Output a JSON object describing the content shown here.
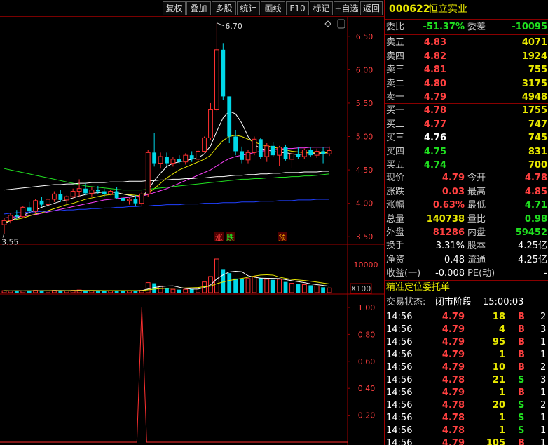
{
  "toolbar": {
    "buttons": [
      "复权",
      "叠加",
      "多股",
      "统计",
      "画线",
      "F10",
      "标记",
      "+自选",
      "返回"
    ]
  },
  "stock": {
    "code": "000622",
    "name": "恒立实业"
  },
  "chart": {
    "price_ticks": [
      "6.50",
      "6.00",
      "5.50",
      "5.00",
      "4.50",
      "4.00",
      "3.50"
    ],
    "high_label": "6.70",
    "low_label": "3.55",
    "markers": [
      {
        "text": "涨",
        "color": "#ff4040"
      },
      {
        "text": "跌",
        "color": "#20e020"
      },
      {
        "text": "预",
        "color": "#e8a000"
      }
    ],
    "volume_tick": "10000",
    "volume_unit": "X100",
    "indicator_ticks": [
      "1.00",
      "0.80",
      "0.60",
      "0.40",
      "0.20"
    ]
  },
  "chart_data": {
    "type": "candlestick",
    "ylim": [
      3.45,
      6.75
    ],
    "candles": [
      {
        "o": 3.68,
        "h": 3.78,
        "l": 3.55,
        "c": 3.74
      },
      {
        "o": 3.74,
        "h": 3.86,
        "l": 3.7,
        "c": 3.82
      },
      {
        "o": 3.82,
        "h": 3.9,
        "l": 3.76,
        "c": 3.8
      },
      {
        "o": 3.8,
        "h": 3.96,
        "l": 3.78,
        "c": 3.94
      },
      {
        "o": 3.94,
        "h": 4.02,
        "l": 3.86,
        "c": 3.88
      },
      {
        "o": 3.88,
        "h": 4.06,
        "l": 3.86,
        "c": 4.04
      },
      {
        "o": 4.04,
        "h": 4.1,
        "l": 3.95,
        "c": 3.98
      },
      {
        "o": 3.98,
        "h": 4.08,
        "l": 3.94,
        "c": 4.06
      },
      {
        "o": 4.06,
        "h": 4.18,
        "l": 4.02,
        "c": 4.14
      },
      {
        "o": 4.14,
        "h": 4.2,
        "l": 4.02,
        "c": 4.05
      },
      {
        "o": 4.05,
        "h": 4.12,
        "l": 4.0,
        "c": 4.1
      },
      {
        "o": 4.1,
        "h": 4.22,
        "l": 4.08,
        "c": 4.18
      },
      {
        "o": 4.18,
        "h": 4.36,
        "l": 4.1,
        "c": 4.22
      },
      {
        "o": 4.22,
        "h": 4.3,
        "l": 4.12,
        "c": 4.15
      },
      {
        "o": 4.15,
        "h": 4.24,
        "l": 4.1,
        "c": 4.2
      },
      {
        "o": 4.2,
        "h": 4.26,
        "l": 4.14,
        "c": 4.18
      },
      {
        "o": 4.18,
        "h": 4.22,
        "l": 4.1,
        "c": 4.14
      },
      {
        "o": 4.14,
        "h": 4.2,
        "l": 4.12,
        "c": 4.18
      },
      {
        "o": 4.18,
        "h": 4.24,
        "l": 4.06,
        "c": 4.08
      },
      {
        "o": 4.08,
        "h": 4.14,
        "l": 4.0,
        "c": 4.04
      },
      {
        "o": 4.04,
        "h": 4.08,
        "l": 3.98,
        "c": 4.06
      },
      {
        "o": 4.06,
        "h": 4.12,
        "l": 3.96,
        "c": 4.0
      },
      {
        "o": 4.0,
        "h": 4.18,
        "l": 3.96,
        "c": 4.14
      },
      {
        "o": 4.14,
        "h": 4.8,
        "l": 4.1,
        "c": 4.76
      },
      {
        "o": 4.76,
        "h": 5.05,
        "l": 4.55,
        "c": 4.6
      },
      {
        "o": 4.6,
        "h": 4.76,
        "l": 4.52,
        "c": 4.7
      },
      {
        "o": 4.7,
        "h": 4.76,
        "l": 4.56,
        "c": 4.6
      },
      {
        "o": 4.6,
        "h": 4.7,
        "l": 4.55,
        "c": 4.66
      },
      {
        "o": 4.66,
        "h": 4.72,
        "l": 4.6,
        "c": 4.62
      },
      {
        "o": 4.62,
        "h": 4.75,
        "l": 4.58,
        "c": 4.72
      },
      {
        "o": 4.72,
        "h": 4.78,
        "l": 4.62,
        "c": 4.66
      },
      {
        "o": 4.66,
        "h": 4.8,
        "l": 4.62,
        "c": 4.78
      },
      {
        "o": 4.78,
        "h": 5.0,
        "l": 4.76,
        "c": 4.98
      },
      {
        "o": 4.98,
        "h": 5.5,
        "l": 4.95,
        "c": 5.4
      },
      {
        "o": 5.4,
        "h": 6.7,
        "l": 5.38,
        "c": 6.3
      },
      {
        "o": 6.3,
        "h": 6.4,
        "l": 5.55,
        "c": 5.6
      },
      {
        "o": 5.6,
        "h": 5.3,
        "l": 4.9,
        "c": 5.0
      },
      {
        "o": 5.0,
        "h": 5.1,
        "l": 4.72,
        "c": 4.78
      },
      {
        "o": 4.78,
        "h": 4.85,
        "l": 4.6,
        "c": 4.65
      },
      {
        "o": 4.65,
        "h": 4.8,
        "l": 4.6,
        "c": 4.76
      },
      {
        "o": 4.76,
        "h": 5.0,
        "l": 4.72,
        "c": 4.96
      },
      {
        "o": 4.96,
        "h": 4.98,
        "l": 4.66,
        "c": 4.7
      },
      {
        "o": 4.7,
        "h": 4.9,
        "l": 4.62,
        "c": 4.86
      },
      {
        "o": 4.86,
        "h": 4.92,
        "l": 4.7,
        "c": 4.72
      },
      {
        "o": 4.72,
        "h": 4.86,
        "l": 4.56,
        "c": 4.84
      },
      {
        "o": 4.84,
        "h": 4.88,
        "l": 4.64,
        "c": 4.66
      },
      {
        "o": 4.66,
        "h": 4.76,
        "l": 4.52,
        "c": 4.74
      },
      {
        "o": 4.74,
        "h": 4.84,
        "l": 4.66,
        "c": 4.7
      },
      {
        "o": 4.7,
        "h": 4.82,
        "l": 4.66,
        "c": 4.8
      },
      {
        "o": 4.8,
        "h": 4.84,
        "l": 4.7,
        "c": 4.72
      },
      {
        "o": 4.72,
        "h": 4.82,
        "l": 4.68,
        "c": 4.78
      },
      {
        "o": 4.78,
        "h": 4.84,
        "l": 4.6,
        "c": 4.74
      },
      {
        "o": 4.74,
        "h": 4.85,
        "l": 4.71,
        "c": 4.79
      }
    ],
    "ma_lines": [
      {
        "color": "#ffffff",
        "values": [
          3.7,
          3.74,
          3.78,
          3.82,
          3.86,
          3.9,
          3.94,
          3.97,
          4.0,
          4.03,
          4.05,
          4.08,
          4.11,
          4.13,
          4.15,
          4.16,
          4.17,
          4.17,
          4.16,
          4.14,
          4.12,
          4.1,
          4.09,
          4.2,
          4.34,
          4.45,
          4.55,
          4.6,
          4.62,
          4.64,
          4.66,
          4.68,
          4.74,
          4.86,
          5.08,
          5.28,
          5.38,
          5.34,
          5.2,
          5.0,
          4.88,
          4.82,
          4.8,
          4.78,
          4.76,
          4.76,
          4.74,
          4.73,
          4.74,
          4.74,
          4.75,
          4.75,
          4.76
        ]
      },
      {
        "color": "#e8e800",
        "values": [
          3.72,
          3.74,
          3.76,
          3.78,
          3.81,
          3.84,
          3.86,
          3.89,
          3.92,
          3.95,
          3.98,
          4.0,
          4.03,
          4.06,
          4.08,
          4.1,
          4.12,
          4.13,
          4.14,
          4.14,
          4.13,
          4.12,
          4.11,
          4.15,
          4.22,
          4.3,
          4.38,
          4.44,
          4.5,
          4.54,
          4.58,
          4.62,
          4.66,
          4.72,
          4.84,
          4.94,
          5.0,
          5.02,
          5.0,
          4.96,
          4.92,
          4.88,
          4.86,
          4.84,
          4.82,
          4.8,
          4.78,
          4.77,
          4.76,
          4.76,
          4.76,
          4.76,
          4.76
        ]
      },
      {
        "color": "#ff40ff",
        "values": [
          3.78,
          3.79,
          3.8,
          3.81,
          3.82,
          3.83,
          3.85,
          3.87,
          3.89,
          3.91,
          3.93,
          3.95,
          3.97,
          3.99,
          4.01,
          4.03,
          4.05,
          4.06,
          4.07,
          4.08,
          4.09,
          4.1,
          4.11,
          4.13,
          4.16,
          4.19,
          4.22,
          4.26,
          4.3,
          4.34,
          4.38,
          4.42,
          4.46,
          4.5,
          4.56,
          4.62,
          4.67,
          4.7,
          4.72,
          4.74,
          4.76,
          4.78,
          4.79,
          4.8,
          4.81,
          4.82,
          4.82,
          4.83,
          4.83,
          4.84,
          4.84,
          4.84,
          4.84
        ]
      },
      {
        "color": "#20e020",
        "values": [
          4.52,
          4.5,
          4.48,
          4.46,
          4.44,
          4.42,
          4.4,
          4.38,
          4.36,
          4.34,
          4.32,
          4.3,
          4.28,
          4.26,
          4.25,
          4.24,
          4.23,
          4.22,
          4.21,
          4.2,
          4.2,
          4.2,
          4.2,
          4.21,
          4.22,
          4.23,
          4.24,
          4.25,
          4.26,
          4.27,
          4.28,
          4.29,
          4.3,
          4.31,
          4.32,
          4.33,
          4.34,
          4.35,
          4.36,
          4.36,
          4.37,
          4.37,
          4.38,
          4.38,
          4.39,
          4.39,
          4.4,
          4.4,
          4.41,
          4.41,
          4.42,
          4.43,
          4.44
        ]
      },
      {
        "color": "#ffffff",
        "values": [
          4.2,
          4.21,
          4.22,
          4.23,
          4.24,
          4.25,
          4.26,
          4.27,
          4.28,
          4.28,
          4.29,
          4.29,
          4.3,
          4.3,
          4.31,
          4.31,
          4.31,
          4.32,
          4.32,
          4.32,
          4.33,
          4.33,
          4.33,
          4.34,
          4.34,
          4.35,
          4.35,
          4.36,
          4.36,
          4.37,
          4.37,
          4.38,
          4.38,
          4.39,
          4.4,
          4.4,
          4.41,
          4.42,
          4.42,
          4.43,
          4.43,
          4.44,
          4.44,
          4.45,
          4.45,
          4.46,
          4.46,
          4.46,
          4.47,
          4.47,
          4.47,
          4.48,
          4.48
        ]
      },
      {
        "color": "#2040ff",
        "values": [
          3.84,
          3.85,
          3.86,
          3.86,
          3.87,
          3.87,
          3.88,
          3.88,
          3.89,
          3.89,
          3.9,
          3.9,
          3.91,
          3.91,
          3.92,
          3.92,
          3.93,
          3.93,
          3.94,
          3.94,
          3.95,
          3.95,
          3.96,
          3.96,
          3.97,
          3.97,
          3.98,
          3.98,
          3.98,
          3.99,
          3.99,
          3.99,
          4.0,
          4.0,
          4.0,
          4.01,
          4.01,
          4.01,
          4.02,
          4.02,
          4.02,
          4.03,
          4.03,
          4.03,
          4.04,
          4.04,
          4.04,
          4.05,
          4.05,
          4.05,
          4.06,
          4.06,
          4.06
        ]
      }
    ],
    "volume": [
      6,
      5,
      6,
      5,
      6,
      7,
      6,
      6,
      7,
      6,
      6,
      7,
      8,
      6,
      6,
      5,
      6,
      6,
      7,
      6,
      6,
      6,
      7,
      30,
      28,
      20,
      14,
      10,
      9,
      10,
      11,
      14,
      32,
      48,
      100,
      70,
      58,
      42,
      40,
      42,
      48,
      44,
      40,
      38,
      40,
      32,
      28,
      26,
      24,
      22,
      20,
      16,
      14
    ],
    "indicator": {
      "spike_index": 22,
      "value": 1.0
    }
  },
  "quote": {
    "weibi_label": "委比",
    "weibi": "-51.37%",
    "weicha_label": "委差",
    "weicha": "-10095",
    "asks": [
      {
        "label": "卖五",
        "price": "4.83",
        "vol": "4071"
      },
      {
        "label": "卖四",
        "price": "4.82",
        "vol": "1924"
      },
      {
        "label": "卖三",
        "price": "4.81",
        "vol": "755"
      },
      {
        "label": "卖二",
        "price": "4.80",
        "vol": "3175"
      },
      {
        "label": "卖一",
        "price": "4.79",
        "vol": "4948"
      }
    ],
    "bids": [
      {
        "label": "买一",
        "price": "4.78",
        "vol": "1755",
        "color": "#ff4040"
      },
      {
        "label": "买二",
        "price": "4.77",
        "vol": "747",
        "color": "#ff4040"
      },
      {
        "label": "买三",
        "price": "4.76",
        "vol": "745",
        "color": "#ffffff"
      },
      {
        "label": "买四",
        "price": "4.75",
        "vol": "831",
        "color": "#20e020"
      },
      {
        "label": "买五",
        "price": "4.74",
        "vol": "700",
        "color": "#20e020"
      }
    ],
    "stats": [
      {
        "l1": "现价",
        "v1": "4.79",
        "c1": "#ff4040",
        "l2": "今开",
        "v2": "4.78",
        "c2": "#ff4040"
      },
      {
        "l1": "涨跌",
        "v1": "0.03",
        "c1": "#ff4040",
        "l2": "最高",
        "v2": "4.85",
        "c2": "#ff4040"
      },
      {
        "l1": "涨幅",
        "v1": "0.63%",
        "c1": "#ff4040",
        "l2": "最低",
        "v2": "4.71",
        "c2": "#20e020"
      },
      {
        "l1": "总量",
        "v1": "140738",
        "c1": "#e8e800",
        "l2": "量比",
        "v2": "0.98",
        "c2": "#20e020"
      },
      {
        "l1": "外盘",
        "v1": "81286",
        "c1": "#ff4040",
        "l2": "内盘",
        "v2": "59452",
        "c2": "#20e020"
      }
    ],
    "finance": [
      {
        "l1": "换手",
        "v1": "3.31%",
        "l2": "股本",
        "v2": "4.25亿"
      },
      {
        "l1": "净资",
        "v1": "0.48",
        "l2": "流通",
        "v2": "4.25亿"
      },
      {
        "l1": "收益(一)",
        "v1": "-0.008",
        "l2": "PE(动)",
        "v2": "-"
      }
    ]
  },
  "orders": {
    "title": "精准定位委托单",
    "status_label": "交易状态:",
    "status": "闭市阶段",
    "time": "15:00:03",
    "rows": [
      {
        "t": "14:56",
        "p": "4.79",
        "v": "18",
        "s": "B",
        "n": "2"
      },
      {
        "t": "14:56",
        "p": "4.79",
        "v": "4",
        "s": "B",
        "n": "3"
      },
      {
        "t": "14:56",
        "p": "4.79",
        "v": "95",
        "s": "B",
        "n": "1"
      },
      {
        "t": "14:56",
        "p": "4.79",
        "v": "1",
        "s": "B",
        "n": "1"
      },
      {
        "t": "14:56",
        "p": "4.79",
        "v": "10",
        "s": "B",
        "n": "2"
      },
      {
        "t": "14:56",
        "p": "4.78",
        "v": "21",
        "s": "S",
        "n": "3"
      },
      {
        "t": "14:56",
        "p": "4.79",
        "v": "1",
        "s": "B",
        "n": "1"
      },
      {
        "t": "14:56",
        "p": "4.78",
        "v": "20",
        "s": "S",
        "n": "2"
      },
      {
        "t": "14:56",
        "p": "4.78",
        "v": "1",
        "s": "S",
        "n": "1"
      },
      {
        "t": "14:56",
        "p": "4.78",
        "v": "1",
        "s": "S",
        "n": "1"
      },
      {
        "t": "14:56",
        "p": "4.79",
        "v": "105",
        "s": "B",
        "n": "1"
      }
    ]
  }
}
